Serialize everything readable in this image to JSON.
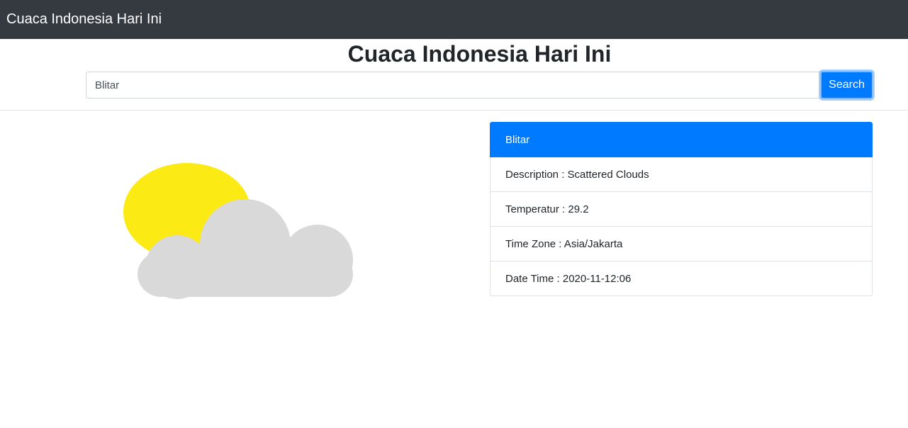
{
  "navbar": {
    "brand": "Cuaca Indonesia Hari Ini"
  },
  "header": {
    "title": "Cuaca Indonesia Hari Ini"
  },
  "search": {
    "value": "Blitar",
    "button_label": "Search"
  },
  "weather": {
    "icon": "sun-behind-cloud-icon",
    "city": "Blitar",
    "details": [
      "Description : Scattered Clouds",
      "Temperatur : 29.2",
      "Time Zone : Asia/Jakarta",
      "Date Time : 2020-11-12:06"
    ]
  },
  "colors": {
    "navbar": "#343a40",
    "primary": "#007bff",
    "sun": "#fcea14",
    "cloud": "#d9d9d9"
  }
}
